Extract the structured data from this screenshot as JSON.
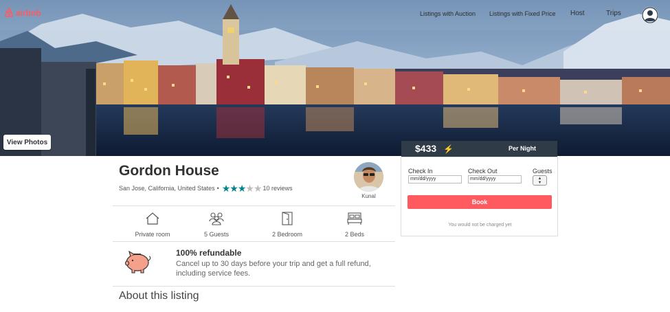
{
  "brand": {
    "name": "airbnb",
    "accent": "#ff5a5f"
  },
  "nav": {
    "links": [
      "Listings with Auction",
      "Listings with Fixed Price",
      "Host",
      "Trips"
    ]
  },
  "hero": {
    "view_photos_label": "View Photos"
  },
  "booking": {
    "price": "$433",
    "per_night": "Per Night",
    "check_in_label": "Check In",
    "check_out_label": "Check Out",
    "guests_label": "Guests",
    "check_in_placeholder": "mm/dd/yyyy",
    "check_out_placeholder": "mm/dd/yyyy",
    "book_label": "Book",
    "note": "You would not be charged yet",
    "header_color": "#2f3b47",
    "button_color": "#ff5a5f"
  },
  "listing": {
    "title": "Gordon House",
    "location": "San Jose, California, United States",
    "separator": "•",
    "rating": 3,
    "rating_max": 5,
    "reviews": "10 reviews",
    "host_name": "Kunal",
    "star_color": "#008489"
  },
  "amenities": [
    {
      "icon": "house-icon",
      "label": "Private room"
    },
    {
      "icon": "guests-icon",
      "label": "5 Guests"
    },
    {
      "icon": "door-icon",
      "label": "2 Bedroom"
    },
    {
      "icon": "bed-icon",
      "label": "2 Beds"
    }
  ],
  "refund": {
    "icon": "piggy-bank-icon",
    "title": "100% refundable",
    "text": "Cancel up to 30 days before your trip and get a full refund, including service fees."
  },
  "about": {
    "heading": "About this listing"
  }
}
